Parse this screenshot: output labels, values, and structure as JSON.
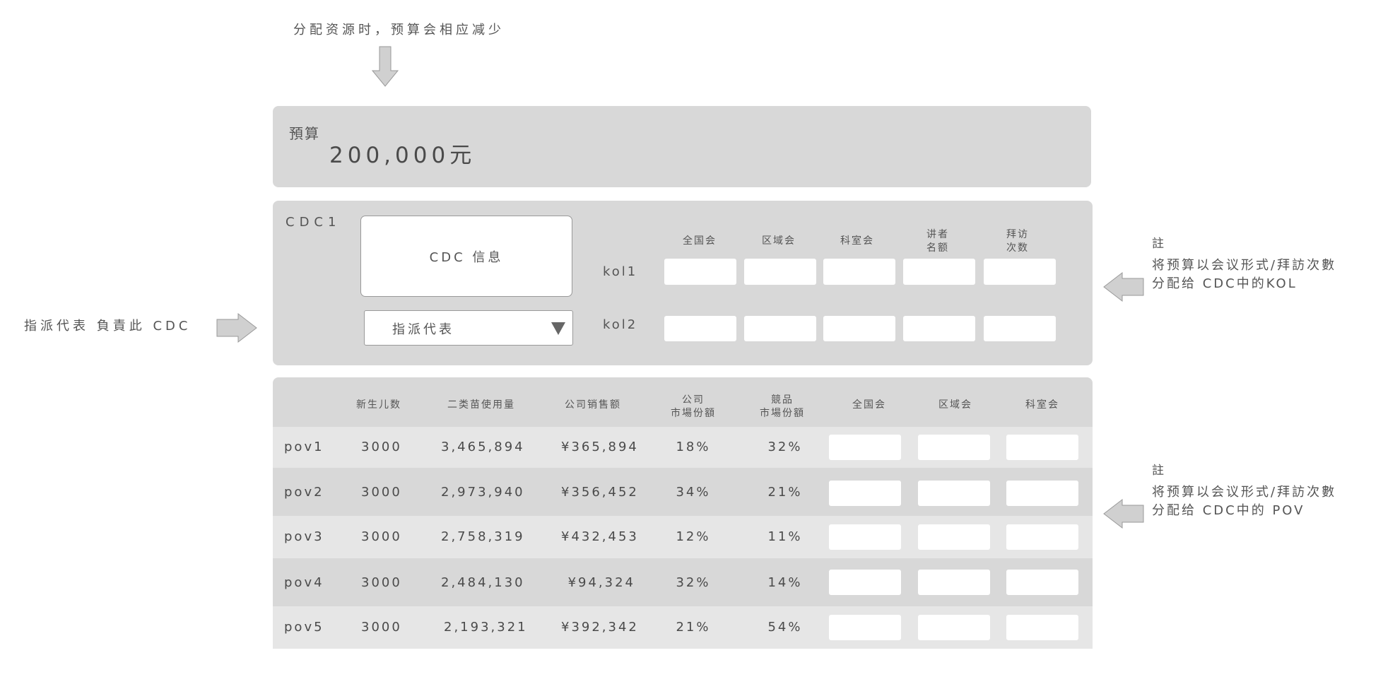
{
  "top_note": "分配资源时，预算会相应减少",
  "budget": {
    "label": "預算",
    "amount": "200,000元"
  },
  "cdc": {
    "label": "CDC1",
    "info": "CDC 信息",
    "assign_select": "指派代表",
    "columns": [
      {
        "line1": "全国会",
        "line2": ""
      },
      {
        "line1": "区域会",
        "line2": ""
      },
      {
        "line1": "科室会",
        "line2": ""
      },
      {
        "line1": "讲者",
        "line2": "名额"
      },
      {
        "line1": "拜访",
        "line2": "次数"
      }
    ],
    "rows": [
      {
        "label": "kol1"
      },
      {
        "label": "kol2"
      }
    ]
  },
  "left_note": "指派代表 負責此 CDC",
  "note_kol": {
    "title": "註",
    "line1": "将预算以会议形式/拜訪次數",
    "line2": "分配给 CDC中的KOL"
  },
  "note_pov": {
    "title": "註",
    "line1": "将预算以会议形式/拜訪次數",
    "line2": "分配给 CDC中的 POV"
  },
  "table": {
    "headers": [
      {
        "line1": "新生儿数",
        "line2": ""
      },
      {
        "line1": "二类苗使用量",
        "line2": ""
      },
      {
        "line1": "公司销售额",
        "line2": ""
      },
      {
        "line1": "公司",
        "line2": "市場份額"
      },
      {
        "line1": "競品",
        "line2": "市場份額"
      },
      {
        "line1": "全国会",
        "line2": ""
      },
      {
        "line1": "区域会",
        "line2": ""
      },
      {
        "line1": "科室会",
        "line2": ""
      }
    ],
    "rows": [
      {
        "name": "pov1",
        "newborn": "3000",
        "usage": "3,465,894",
        "sales": "¥365,894",
        "share": "18%",
        "competitor": "32%"
      },
      {
        "name": "pov2",
        "newborn": "3000",
        "usage": "2,973,940",
        "sales": "¥356,452",
        "share": "34%",
        "competitor": "21%"
      },
      {
        "name": "pov3",
        "newborn": "3000",
        "usage": "2,758,319",
        "sales": "¥432,453",
        "share": "12%",
        "competitor": "11%"
      },
      {
        "name": "pov4",
        "newborn": "3000",
        "usage": "2,484,130",
        "sales": "¥94,324",
        "share": "32%",
        "competitor": "14%"
      },
      {
        "name": "pov5",
        "newborn": "3000",
        "usage": "2,193,321",
        "sales": "¥392,342",
        "share": "21%",
        "competitor": "54%"
      }
    ]
  },
  "colors": {
    "panel": "#d8d8d8",
    "row_light": "#e6e6e6",
    "row_dark": "#d8d8d8",
    "field": "#ffffff",
    "arrow": "#d0d0d0"
  }
}
